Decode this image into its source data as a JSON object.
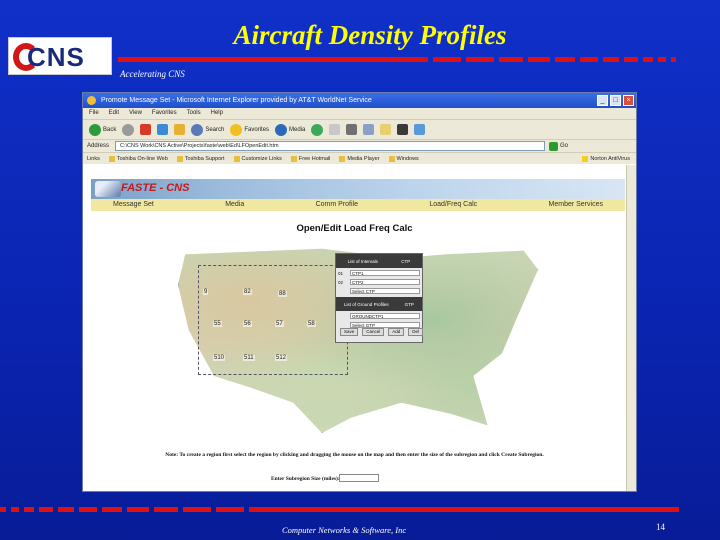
{
  "slide": {
    "title": "Aircraft Density Profiles",
    "logo_text": "CNS",
    "tagline": "Accelerating CNS",
    "footer": "Computer Networks & Software, Inc",
    "page_number": "14",
    "accent_red": "#e01010",
    "title_color": "#ffff00"
  },
  "browser": {
    "title": "Promote Message Set - Microsoft Internet Explorer provided by AT&T WorldNet Service",
    "menu": [
      "File",
      "Edit",
      "View",
      "Favorites",
      "Tools",
      "Help"
    ],
    "toolbar": {
      "back": "Back",
      "search": "Search",
      "favorites": "Favorites",
      "media": "Media"
    },
    "address_label": "Address",
    "address_value": "C:\\CNS Work\\CNS Active\\Projects\\faste\\web\\Ed\\LFOpenEdit.htm",
    "go_label": "Go",
    "links": [
      "Links",
      "Toshiba On-line Web",
      "Toshiba Support",
      "Customize Links",
      "Free Hotmail",
      "Media Player",
      "Windows"
    ],
    "norton": "Norton AntiVirus"
  },
  "app": {
    "name": "FASTE - CNS",
    "nav": [
      "Message Set",
      "Media",
      "Comm Profile",
      "Load/Freq Calc",
      "Member Services"
    ],
    "heading": "Open/Edit Load Freq Calc",
    "grid_cells": [
      "9",
      "82",
      "88",
      "55",
      "56",
      "57",
      "58",
      "510",
      "511",
      "512"
    ],
    "popup": {
      "col1": "List of Intervals",
      "col2": "CTP",
      "rows": [
        {
          "k": "01",
          "v": "CTP1"
        },
        {
          "k": "02",
          "v": "CTP2"
        },
        {
          "k": "",
          "v": "Select CTP"
        }
      ],
      "section2": "List of Ground Profiles",
      "section2_col": "GTP",
      "rows2": [
        {
          "k": "",
          "v": "GROUNDCTP1"
        },
        {
          "k": "",
          "v": "Select GTP"
        }
      ],
      "buttons": [
        "Save",
        "Cancel",
        "Add",
        "Del"
      ]
    },
    "note": "Note: To create a region first select the region by clicking and dragging the mouse on the map and then enter the size of the subregion and click Create Subregion.",
    "subregion_label": "Enter Subregion Size (miles):"
  }
}
